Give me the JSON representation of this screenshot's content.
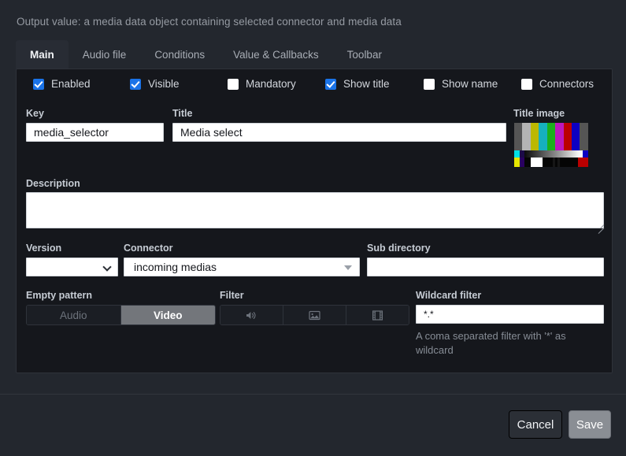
{
  "header": {
    "note": "Output value: a media data object containing selected connector and media data"
  },
  "tabs": [
    {
      "label": "Main",
      "active": true
    },
    {
      "label": "Audio file",
      "active": false
    },
    {
      "label": "Conditions",
      "active": false
    },
    {
      "label": "Value & Callbacks",
      "active": false
    },
    {
      "label": "Toolbar",
      "active": false
    }
  ],
  "checkboxes": [
    {
      "label": "Enabled",
      "checked": true
    },
    {
      "label": "Visible",
      "checked": true
    },
    {
      "label": "Mandatory",
      "checked": false
    },
    {
      "label": "Show title",
      "checked": true
    },
    {
      "label": "Show name",
      "checked": false
    },
    {
      "label": "Connectors",
      "checked": false
    }
  ],
  "fields": {
    "key": {
      "label": "Key",
      "value": "media_selector",
      "placeholder": ""
    },
    "title": {
      "label": "Title",
      "value": "Media select",
      "placeholder": ""
    },
    "title_image": {
      "label": "Title image",
      "icon": "color-bars-test-pattern"
    },
    "description": {
      "label": "Description",
      "value": "",
      "placeholder": ""
    },
    "version": {
      "label": "Version",
      "value": "",
      "options": [
        ""
      ]
    },
    "connector": {
      "label": "Connector",
      "value": "incoming medias",
      "options": [
        "incoming medias"
      ]
    },
    "sub_directory": {
      "label": "Sub directory",
      "value": "",
      "placeholder": ""
    },
    "wildcard_filter": {
      "label": "Wildcard filter",
      "value": "*.*",
      "placeholder": "",
      "help": "A coma separated filter with '*' as wildcard"
    }
  },
  "empty_pattern": {
    "label": "Empty pattern",
    "options": [
      {
        "label": "Audio",
        "selected": false
      },
      {
        "label": "Video",
        "selected": true
      }
    ]
  },
  "filter": {
    "label": "Filter",
    "options": [
      {
        "icon": "speaker-icon",
        "selected": false
      },
      {
        "icon": "image-icon",
        "selected": false
      },
      {
        "icon": "film-icon",
        "selected": false
      }
    ]
  },
  "footer": {
    "cancel_label": "Cancel",
    "save_label": "Save"
  },
  "colors": {
    "accent": "#1a73e8",
    "panel_bg": "#15171c",
    "window_bg": "#23272e",
    "save_bg": "#8a8e94"
  }
}
